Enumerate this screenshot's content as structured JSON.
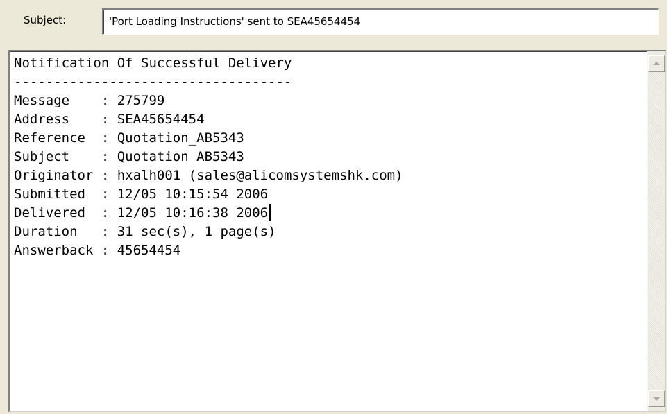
{
  "subject": {
    "label": "Subject:",
    "value": "'Port Loading Instructions' sent to SEA45654454"
  },
  "message": {
    "title": "Notification Of Successful Delivery",
    "separator": "-----------------------------------",
    "fields": [
      {
        "label": "Message    ",
        "value": "275799"
      },
      {
        "label": "Address    ",
        "value": "SEA45654454"
      },
      {
        "label": "Reference  ",
        "value": "Quotation_AB5343"
      },
      {
        "label": "Subject    ",
        "value": "Quotation AB5343"
      },
      {
        "label": "Originator ",
        "value": "hxalh001 (sales@alicomsystemshk.com)"
      },
      {
        "label": "Submitted  ",
        "value": "12/05 10:15:54 2006"
      },
      {
        "label": "Delivered  ",
        "value": "12/05 10:16:38 2006"
      },
      {
        "label": "Duration   ",
        "value": "31 sec(s), 1 page(s)"
      },
      {
        "label": "Answerback ",
        "value": "45654454"
      }
    ],
    "colon": ": "
  },
  "scrollbar": {
    "up_icon": "scroll-up-arrow-icon",
    "down_icon": "scroll-down-arrow-icon"
  }
}
